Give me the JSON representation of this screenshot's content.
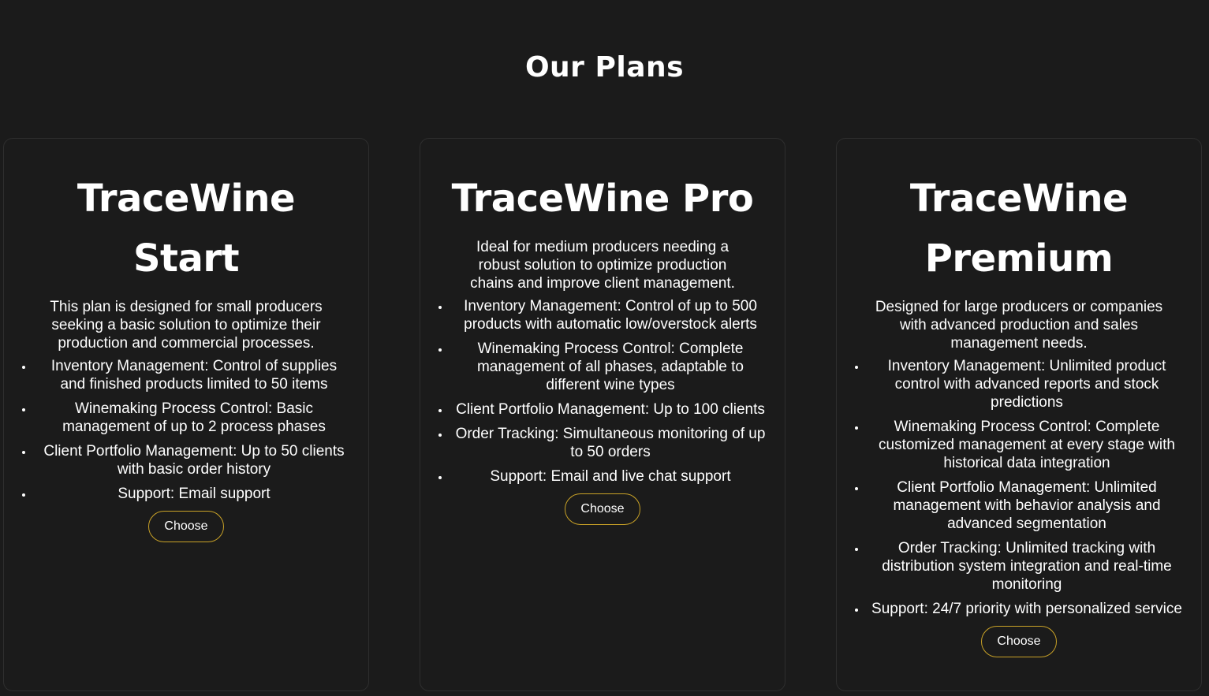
{
  "page": {
    "title": "Our Plans"
  },
  "colors": {
    "background": "#1b1b1b",
    "card_border": "#2e2e2e",
    "button_border": "#c9a227",
    "text": "#ffffff"
  },
  "plans": [
    {
      "name": "TraceWine Start",
      "description": "This plan is designed for small producers seeking a basic solution to optimize their production and commercial processes.",
      "features": [
        "Inventory Management: Control of supplies and finished products limited to 50 items",
        "Winemaking Process Control: Basic management of up to 2 process phases",
        "Client Portfolio Management: Up to 50 clients with basic order history",
        "Support: Email support"
      ],
      "button_label": "Choose"
    },
    {
      "name": "TraceWine Pro",
      "description": "Ideal for medium producers needing a robust solution to optimize production chains and improve client management.",
      "features": [
        "Inventory Management: Control of up to 500 products with automatic low/overstock alerts",
        "Winemaking Process Control: Complete management of all phases, adaptable to different wine types",
        "Client Portfolio Management: Up to 100 clients",
        "Order Tracking: Simultaneous monitoring of up to 50 orders",
        "Support: Email and live chat support"
      ],
      "button_label": "Choose"
    },
    {
      "name": "TraceWine Premium",
      "description": "Designed for large producers or companies with advanced production and sales management needs.",
      "features": [
        "Inventory Management: Unlimited product control with advanced reports and stock predictions",
        "Winemaking Process Control: Complete customized management at every stage with historical data integration",
        "Client Portfolio Management: Unlimited management with behavior analysis and advanced segmentation",
        "Order Tracking: Unlimited tracking with distribution system integration and real-time monitoring",
        "Support: 24/7 priority with personalized service"
      ],
      "button_label": "Choose"
    }
  ]
}
